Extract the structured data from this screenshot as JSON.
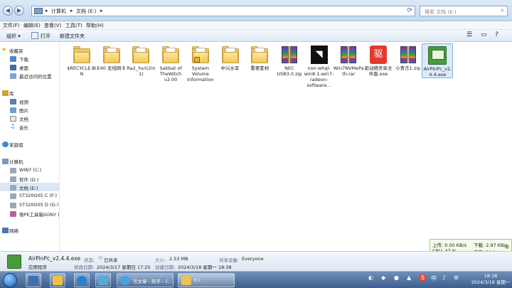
{
  "address": {
    "crumbs": [
      "计算机",
      "文档 (E:)"
    ],
    "separator": "▸"
  },
  "search": {
    "placeholder": "搜索 文档 (E:)"
  },
  "menu": [
    "文件(F)",
    "编辑(E)",
    "查看(V)",
    "工具(T)",
    "帮助(H)"
  ],
  "toolbar": {
    "organize": "组织 ▾",
    "open": "打开",
    "new_folder": "新建文件夹"
  },
  "sidebar": {
    "favorites": {
      "title": "收藏夹",
      "items": [
        "下载",
        "桌面",
        "最近访问的位置"
      ]
    },
    "libraries": {
      "title": "库",
      "items": [
        "视频",
        "图片",
        "文档",
        "音乐"
      ]
    },
    "homegroup": "家庭组",
    "computer": {
      "title": "计算机",
      "items": [
        "WIN7 (C:)",
        "软件 (D:)",
        "文档 (E:)",
        "ST320G05 C (F:)",
        "ST320G05 D (G:)",
        "微PE工具箱SONY ("
      ]
    },
    "network": "网络"
  },
  "files": [
    {
      "name": "$RECYCLE.BIN",
      "type": "folder-empty"
    },
    {
      "name": "E40 无线网卡",
      "type": "folder"
    },
    {
      "name": "Ra2_Yuri(2in1)",
      "type": "folder"
    },
    {
      "name": "Sabbat of TheWitch v2.00",
      "type": "folder"
    },
    {
      "name": "System Volume Information",
      "type": "folder-locked"
    },
    {
      "name": "中兴水军",
      "type": "folder"
    },
    {
      "name": "重要素材",
      "type": "folder"
    },
    {
      "name": "NEC USB3.0.zip",
      "type": "zip"
    },
    {
      "name": "non-whql-win8.1-win7-radeon-software...",
      "type": "amd"
    },
    {
      "name": "Win7NVMePath.rar",
      "type": "zip"
    },
    {
      "name": "驱动精灵单文件版.exe",
      "type": "red"
    },
    {
      "name": "小青言1.zip",
      "type": "zip"
    },
    {
      "name": "AirPinPc_v2.4.4.exe",
      "type": "app",
      "selected": true
    }
  ],
  "details": {
    "filename": "AirPinPc_v2.4.4.exe",
    "filetype": "应用程序",
    "status_label": "状态:",
    "status": "已共享",
    "size_label": "大小:",
    "size": "2.53 MB",
    "modified_label": "修改日期:",
    "modified": "2024/3/17 星期日 17:25",
    "created_label": "创建日期:",
    "created": "2024/3/18 星期一 18:38",
    "share_label": "共享设备:",
    "share": "Everyone"
  },
  "netmon": {
    "up": "上传: 0.00 KB/s",
    "down": "下载: 2.97 KB/s",
    "cpu": "CPU: 47 %",
    "mem": "内存: 50 %"
  },
  "taskbar": {
    "items": [
      {
        "label": "写文章 - 知乎 - C...",
        "color": "#4aa0e6"
      },
      {
        "label": "E:\\",
        "color": "#e8c45a"
      }
    ],
    "tray": [
      "中",
      "♪",
      "⚙"
    ]
  },
  "clock": {
    "time": "18:38",
    "date": "2024/3/18 星期一"
  }
}
